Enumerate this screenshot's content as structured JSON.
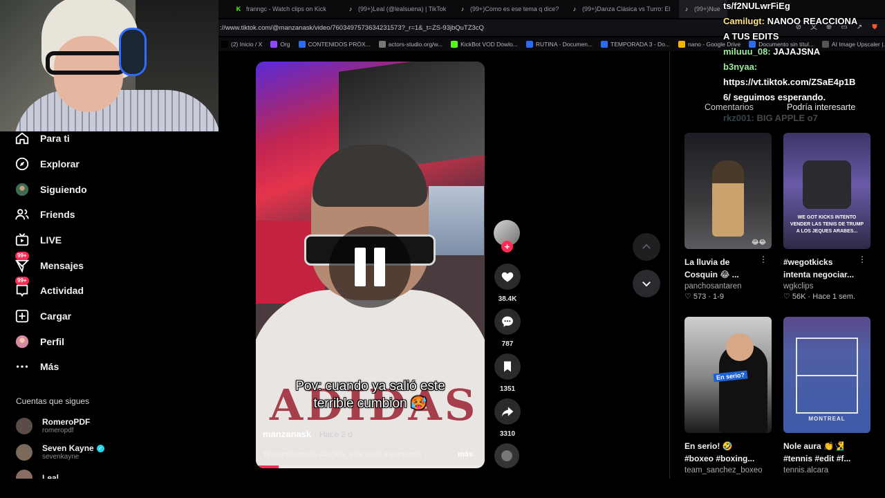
{
  "browser": {
    "tabs": [
      {
        "label": "franngc - Watch clips on Kick",
        "icon": "kick-icon"
      },
      {
        "label": "(99+)Leal (@lealsuena) | TikTok",
        "icon": "tiktok-icon"
      },
      {
        "label": "(99+)Como es ese tema q dice? El m",
        "icon": "tiktok-icon"
      },
      {
        "label": "(99+)Danza Clásica vs Turro: El Gran",
        "icon": "tiktok-icon"
      },
      {
        "label": "(99+)Nue",
        "icon": "tiktok-icon"
      }
    ],
    "url": "://www.tiktok.com/@manzanask/video/7603497573634231573?_r=1&_t=ZS-93jbQuTZ3cQ",
    "bookmarks": [
      {
        "label": "(2) Inicio / X",
        "icon": "x-icon",
        "color": "#000000"
      },
      {
        "label": "Org",
        "icon": "twitch-icon",
        "color": "#9146ff"
      },
      {
        "label": "CONTENIDOS PRÓX...",
        "icon": "doc-icon",
        "color": "#2a6cf2"
      },
      {
        "label": "actors-studio.org/w...",
        "icon": "globe-icon",
        "color": "#777777"
      },
      {
        "label": "KickBot VOD Dowlo...",
        "icon": "kick-icon",
        "color": "#53fc18"
      },
      {
        "label": "RUTINA - Documen...",
        "icon": "doc-icon",
        "color": "#2a6cf2"
      },
      {
        "label": "TEMPORADA 3 - Do...",
        "icon": "doc-icon",
        "color": "#2a6cf2"
      },
      {
        "label": "nano - Google Drive",
        "icon": "drive-icon",
        "color": "#f4b400"
      },
      {
        "label": "Documento sin títul...",
        "icon": "doc-icon",
        "color": "#2a6cf2"
      },
      {
        "label": "AI Image Upscaler |...",
        "icon": "image-icon",
        "color": "#555555"
      }
    ]
  },
  "sidebar": {
    "items": [
      {
        "label": "Para ti",
        "icon": "home-icon"
      },
      {
        "label": "Explorar",
        "icon": "compass-icon"
      },
      {
        "label": "Siguiendo",
        "icon": "avatar-icon"
      },
      {
        "label": "Friends",
        "icon": "friends-icon"
      },
      {
        "label": "LIVE",
        "icon": "live-icon"
      },
      {
        "label": "Mensajes",
        "icon": "messages-icon",
        "badge": "99+"
      },
      {
        "label": "Actividad",
        "icon": "activity-icon",
        "badge": "99+"
      },
      {
        "label": "Cargar",
        "icon": "upload-icon"
      },
      {
        "label": "Perfil",
        "icon": "profile-icon"
      },
      {
        "label": "Más",
        "icon": "more-icon"
      }
    ],
    "following_title": "Cuentas que sigues",
    "accounts": [
      {
        "name": "RomeroPDF",
        "handle": "romeropdf",
        "verified": false
      },
      {
        "name": "Seven Kayne",
        "handle": "sevenkayne",
        "verified": true
      },
      {
        "name": "Leal",
        "handle": "",
        "verified": false
      }
    ]
  },
  "video": {
    "caption_line1": "Pov: cuando ya salió este",
    "caption_line2": "terrible cumbion 🥵",
    "author": "manzanask",
    "time": "· Hace 2 d",
    "description": "Te regalo con la canción, este junte inesperado ...",
    "more_label": "más",
    "progress": 0.1,
    "shirt_print": "ADIDAS"
  },
  "actions": {
    "likes": "38.4K",
    "comments": "787",
    "saves": "1351",
    "shares": "3310"
  },
  "right_panel": {
    "tabs": [
      "Comentarios",
      "Podría interesarte"
    ],
    "cards": [
      {
        "title": "La lluvia de Cosquin 😂 ...",
        "author": "panchosantaren",
        "meta": "573 · 1-9",
        "thumb_text": "😂😂"
      },
      {
        "title": "#wegotkicks intenta negociar...",
        "author": "wgkclips",
        "meta": "56K · Hace 1 sem.",
        "thumb_text": "WE GOT KICKS INTENTO VENDER LAS TENIS DE TRUMP A LOS JEQUES ARABES..."
      },
      {
        "title": "En serio! 🤣 #boxeo #boxing...",
        "author": "team_sanchez_boxeo",
        "meta": "",
        "thumb_text": "En serio?"
      },
      {
        "title": "Nole aura 👏🧏‍♂️ #tennis #edit #f...",
        "author": "tennis.alcara",
        "meta": "",
        "thumb_text": "MONTREAL"
      }
    ]
  },
  "chat": {
    "messages": [
      {
        "user": "",
        "text": "ts/f2NULwrFiEg",
        "style": "white"
      },
      {
        "user": "Camilugt:",
        "text": "NANOO REACCIONA",
        "style": "yellow"
      },
      {
        "user": "",
        "text": "A TUS EDITS",
        "style": "white"
      },
      {
        "user": "miluuu_08:",
        "text": "JAJAJSNA",
        "style": "green"
      },
      {
        "user": "b3nyaa:",
        "text": "",
        "style": "green"
      },
      {
        "user": "",
        "text": "https://vt.tiktok.com/ZSaE4p1B",
        "style": "white"
      },
      {
        "user": "",
        "text": "6/ seguimos esperando.",
        "style": "white"
      },
      {
        "user": "rkz001:",
        "text": "BIG APPLE o7",
        "style": "cyan"
      }
    ]
  },
  "colors": {
    "accent": "#fe2c55",
    "background": "#000000",
    "verified": "#20d5ec"
  }
}
